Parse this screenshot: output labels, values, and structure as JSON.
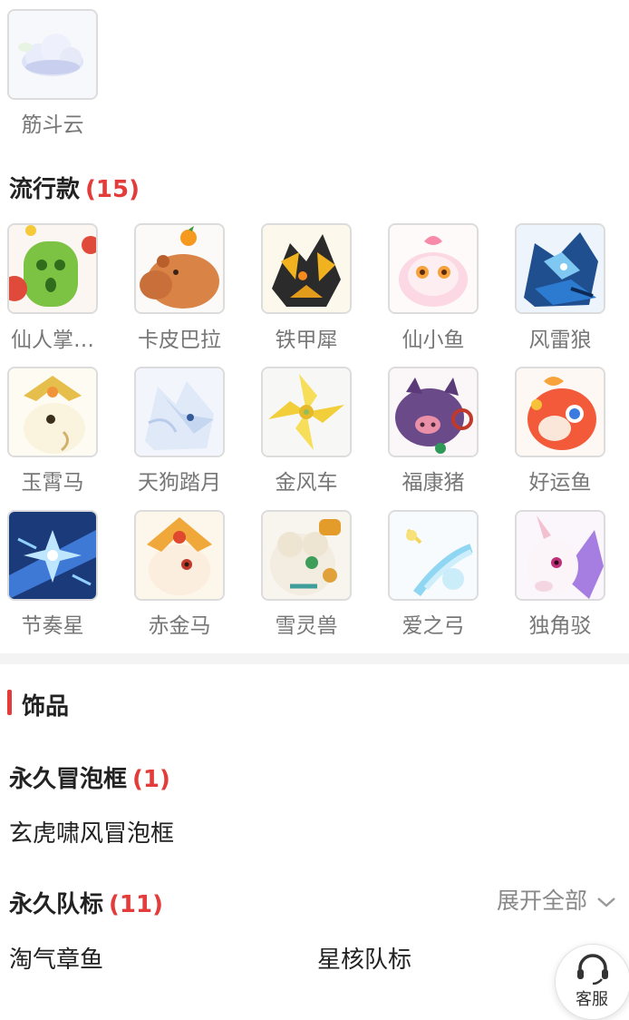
{
  "cloud_item": {
    "label": "筋斗云"
  },
  "popular": {
    "title": "流行款",
    "count": "(15)",
    "items": [
      {
        "label": "仙人掌…",
        "icon": "cactus-mount-icon"
      },
      {
        "label": "卡皮巴拉",
        "icon": "capybara-mount-icon"
      },
      {
        "label": "铁甲犀",
        "icon": "armored-rhino-mount-icon"
      },
      {
        "label": "仙小鱼",
        "icon": "fairy-fish-mount-icon"
      },
      {
        "label": "风雷狼",
        "icon": "thunder-wolf-mount-icon"
      },
      {
        "label": "玉霄马",
        "icon": "jade-horse-mount-icon"
      },
      {
        "label": "天狗踏月",
        "icon": "sky-dog-mount-icon"
      },
      {
        "label": "金风车",
        "icon": "golden-pinwheel-mount-icon"
      },
      {
        "label": "福康猪",
        "icon": "lucky-pig-mount-icon"
      },
      {
        "label": "好运鱼",
        "icon": "lucky-fish-mount-icon"
      },
      {
        "label": "节奏星",
        "icon": "rhythm-star-mount-icon"
      },
      {
        "label": "赤金马",
        "icon": "red-gold-horse-mount-icon"
      },
      {
        "label": "雪灵兽",
        "icon": "snow-beast-mount-icon"
      },
      {
        "label": "爱之弓",
        "icon": "love-bow-mount-icon"
      },
      {
        "label": "独角驳",
        "icon": "unicorn-mount-icon"
      }
    ]
  },
  "accessories": {
    "title": "饰品",
    "bubble_frame": {
      "title": "永久冒泡框",
      "count": "(1)",
      "items": [
        "玄虎啸风冒泡框"
      ]
    },
    "team_badge": {
      "title": "永久队标",
      "count": "(11)",
      "expand_label": "展开全部",
      "items": [
        "淘气章鱼",
        "星核队标"
      ]
    }
  },
  "support": {
    "label": "客服"
  },
  "colors": {
    "accent": "#e43b3b",
    "muted": "#777777"
  }
}
